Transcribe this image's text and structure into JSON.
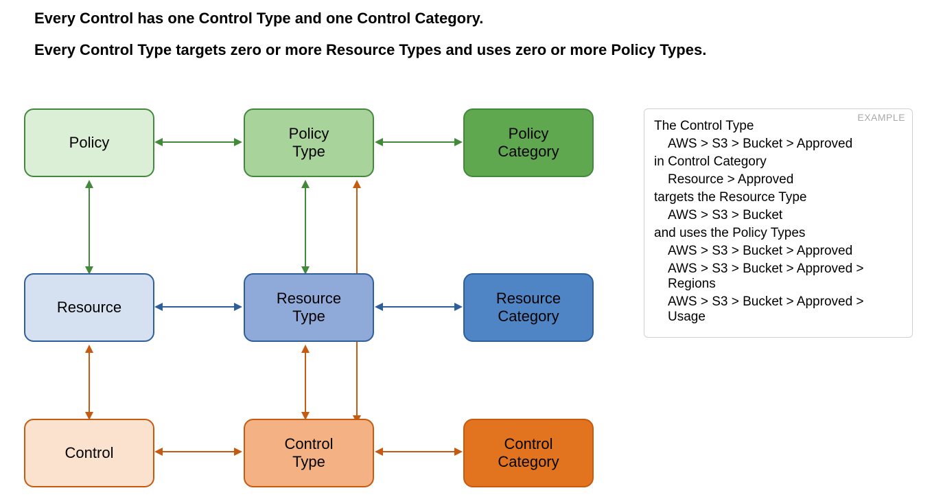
{
  "headings": {
    "h1": "Every Control has one Control Type and one Control Category.",
    "h2": "Every Control Type targets zero or more Resource Types and uses zero or more Policy Types."
  },
  "boxes": {
    "policy": {
      "label": "Policy"
    },
    "policy_type": {
      "label": "Policy\nType"
    },
    "policy_category": {
      "label": "Policy\nCategory"
    },
    "resource": {
      "label": "Resource"
    },
    "resource_type": {
      "label": "Resource\nType"
    },
    "resource_category": {
      "label": "Resource\nCategory"
    },
    "control": {
      "label": "Control"
    },
    "control_type": {
      "label": "Control\nType"
    },
    "control_category": {
      "label": "Control\nCategory"
    }
  },
  "example": {
    "label": "EXAMPLE",
    "lines": [
      {
        "text": "The Control Type",
        "indent": false
      },
      {
        "text": "AWS > S3 > Bucket > Approved",
        "indent": true
      },
      {
        "text": "in Control Category",
        "indent": false
      },
      {
        "text": "Resource > Approved",
        "indent": true
      },
      {
        "text": "targets the Resource Type",
        "indent": false
      },
      {
        "text": "AWS > S3 > Bucket",
        "indent": true
      },
      {
        "text": "and uses the Policy Types",
        "indent": false
      },
      {
        "text": "AWS > S3 > Bucket > Approved",
        "indent": true
      },
      {
        "text": "AWS > S3 > Bucket > Approved > Regions",
        "indent": true
      },
      {
        "text": "AWS > S3 > Bucket > Approved > Usage",
        "indent": true
      }
    ]
  },
  "colors": {
    "green_border": "#43893b",
    "blue_border": "#2e5f9a",
    "orange_border": "#c55a11",
    "policy_fill": "#dbefd7",
    "policy_type_fill": "#a8d39b",
    "policy_category_fill": "#5fa84f",
    "resource_fill": "#d5e0f0",
    "resource_type_fill": "#8faad9",
    "resource_category_fill": "#4f85c5",
    "control_fill": "#fbe2ce",
    "control_type_fill": "#f4b183",
    "control_category_fill": "#e3741f"
  }
}
